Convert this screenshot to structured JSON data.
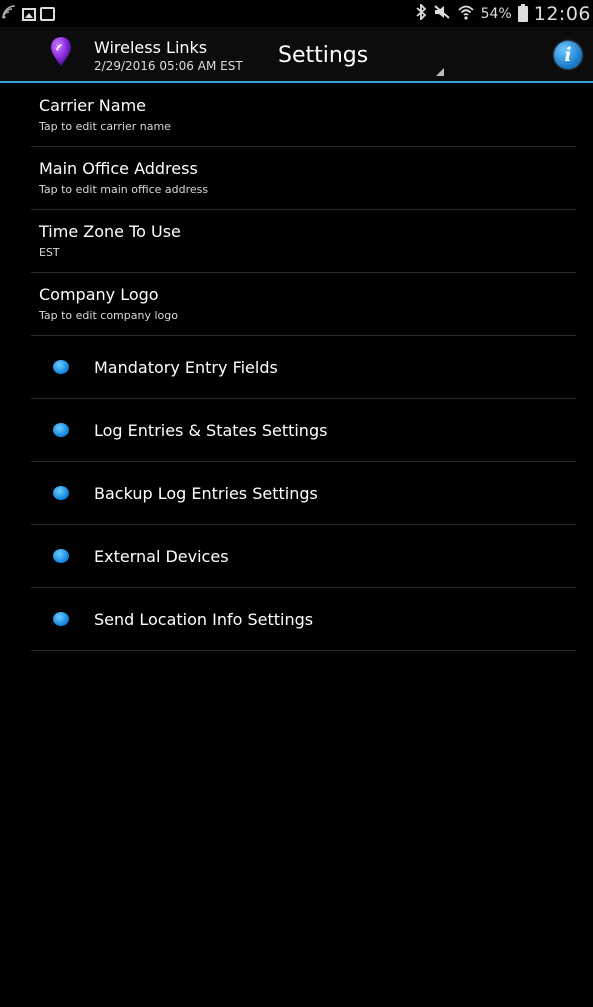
{
  "status_bar": {
    "battery_percent": "54%",
    "time": "12:06",
    "icons": [
      "signal-icon",
      "picture-notification-icon",
      "bag-notification-icon",
      "bluetooth-icon",
      "mute-icon",
      "wifi-icon",
      "battery-icon"
    ]
  },
  "action_bar": {
    "app_name": "Wireless Links",
    "datetime": "2/29/2016 05:06 AM EST",
    "screen_title": "Settings",
    "info_label": "i",
    "accent_color": "#35a3d6"
  },
  "settings": {
    "text_items": [
      {
        "title": "Carrier Name",
        "subtitle": "Tap to edit carrier name"
      },
      {
        "title": "Main Office Address",
        "subtitle": "Tap to edit main office address"
      },
      {
        "title": "Time Zone To Use",
        "subtitle": "EST"
      },
      {
        "title": "Company Logo",
        "subtitle": "Tap to edit company logo"
      }
    ],
    "bullet_items": [
      {
        "label": "Mandatory Entry Fields"
      },
      {
        "label": "Log Entries & States Settings"
      },
      {
        "label": "Backup Log Entries Settings"
      },
      {
        "label": "External Devices"
      },
      {
        "label": "Send Location Info Settings"
      }
    ]
  }
}
